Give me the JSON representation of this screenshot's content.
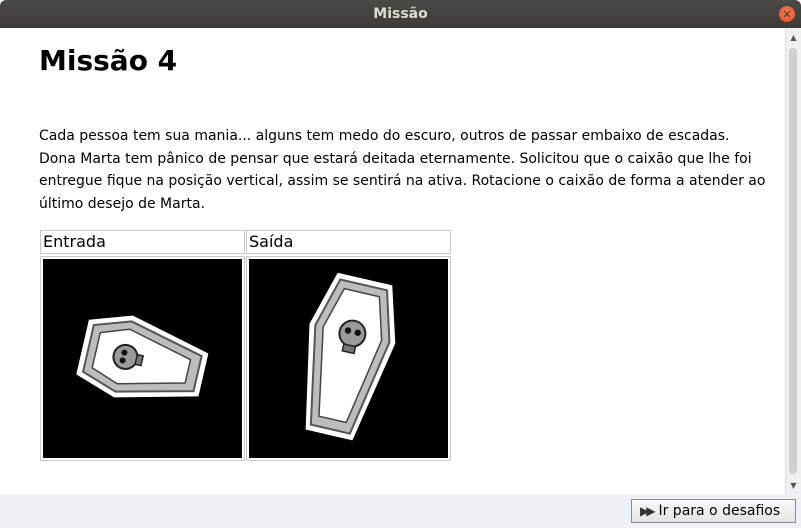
{
  "window": {
    "title": "Missão"
  },
  "mission": {
    "title": "Missão 4",
    "description": "Cada pessoa tem sua mania... alguns tem medo do escuro, outros de passar embaixo de escadas. Dona Marta tem pânico de pensar que estará deitada eternamente. Solicitou que o caixão que lhe foi entregue fique na posição vertical, assim se sentirá na ativa. Rotacione o caixão de forma a atender ao último desejo de Marta."
  },
  "examples": {
    "input_label": "Entrada",
    "output_label": "Saída",
    "input_image_icon": "coffin-horizontal-icon",
    "output_image_icon": "coffin-vertical-icon"
  },
  "footer": {
    "go_button_label": "Ir para o desafios",
    "go_button_icon": "fast-forward-icon"
  }
}
